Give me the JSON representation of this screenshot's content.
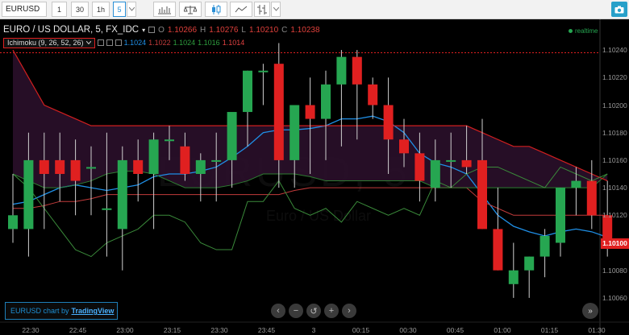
{
  "toolbar": {
    "symbol": "EURUSD",
    "intervals": [
      "1",
      "30",
      "1h",
      "5"
    ],
    "active_interval": "5",
    "icons": [
      "chevron-down-icon",
      "bars-chart-icon",
      "compare-scales-icon",
      "candles-icon",
      "line-chart-icon",
      "indicators-icon",
      "chevron-down-icon",
      "camera-icon"
    ]
  },
  "legend": {
    "title": "EURO / US DOLLAR, 5, FX_IDC",
    "caret": "▾",
    "ohlc": [
      {
        "label": "O",
        "value": "1.10266"
      },
      {
        "label": "H",
        "value": "1.10276"
      },
      {
        "label": "L",
        "value": "1.10210"
      },
      {
        "label": "C",
        "value": "1.10238"
      }
    ],
    "indicator": "Ichimoku (9, 26, 52, 26)",
    "indicator_values": [
      {
        "value": "1.1024",
        "color": "#1f8fe6"
      },
      {
        "value": "1.1022",
        "color": "#c23b3b"
      },
      {
        "value": "1.1024",
        "color": "#2e9e3e"
      },
      {
        "value": "1.1016",
        "color": "#2e9e3e"
      },
      {
        "value": "1.1014",
        "color": "#e04040"
      }
    ],
    "realtime": "realtime"
  },
  "watermark": {
    "symbol": "EURUSD, 5",
    "name": "Euro / US Dollar"
  },
  "footer": {
    "brand_prefix": "EURUSD chart by",
    "brand_name": "TradingView",
    "nav_buttons": [
      "‹",
      "−",
      "↺",
      "+",
      "›"
    ],
    "goto_end": "»"
  },
  "colors": {
    "up": "#26a651",
    "down": "#e02020",
    "tenkan": "#1f8fe6",
    "kijun": "#c23b3b",
    "chikou": "#3a8a3a",
    "cloud": "#2a0f2a",
    "span_a": "#2e7d32",
    "span_b": "#d11f1f"
  },
  "chart_data": {
    "type": "candlestick",
    "symbol": "EURUSD",
    "interval": "5",
    "ylim": [
      1.1005,
      1.1025
    ],
    "y_ticks": [
      "1.10240",
      "1.10220",
      "1.10200",
      "1.10180",
      "1.10160",
      "1.10140",
      "1.10120",
      "1.10100",
      "1.10080",
      "1.10060"
    ],
    "x_ticks": [
      "22:30",
      "22:45",
      "23:00",
      "23:15",
      "23:30",
      "23:45",
      "3",
      "00:15",
      "00:30",
      "00:45",
      "01:00",
      "01:15",
      "01:30"
    ],
    "last_price": "1.10100",
    "resistance_line": 1.10238,
    "candles": [
      {
        "o": 1.1011,
        "h": 1.1015,
        "l": 1.101,
        "c": 1.1012
      },
      {
        "o": 1.1011,
        "h": 1.1018,
        "l": 1.1009,
        "c": 1.1016
      },
      {
        "o": 1.1016,
        "h": 1.1018,
        "l": 1.1011,
        "c": 1.1015
      },
      {
        "o": 1.1016,
        "h": 1.1018,
        "l": 1.1013,
        "c": 1.1015
      },
      {
        "o": 1.1016,
        "h": 1.10175,
        "l": 1.1012,
        "c": 1.10145
      },
      {
        "o": 1.10155,
        "h": 1.1017,
        "l": 1.1012,
        "c": 1.10155
      },
      {
        "o": 1.10125,
        "h": 1.1018,
        "l": 1.1009,
        "c": 1.10125
      },
      {
        "o": 1.1011,
        "h": 1.1017,
        "l": 1.1008,
        "c": 1.1016
      },
      {
        "o": 1.1016,
        "h": 1.10175,
        "l": 1.1013,
        "c": 1.1015
      },
      {
        "o": 1.1015,
        "h": 1.1018,
        "l": 1.1011,
        "c": 1.10175
      },
      {
        "o": 1.10175,
        "h": 1.10185,
        "l": 1.1016,
        "c": 1.10175
      },
      {
        "o": 1.1017,
        "h": 1.1018,
        "l": 1.10145,
        "c": 1.1015
      },
      {
        "o": 1.1015,
        "h": 1.10165,
        "l": 1.1013,
        "c": 1.1016
      },
      {
        "o": 1.1016,
        "h": 1.1018,
        "l": 1.1013,
        "c": 1.1016
      },
      {
        "o": 1.1016,
        "h": 1.10175,
        "l": 1.1014,
        "c": 1.10195
      },
      {
        "o": 1.10195,
        "h": 1.10225,
        "l": 1.1017,
        "c": 1.10225
      },
      {
        "o": 1.10225,
        "h": 1.1023,
        "l": 1.102,
        "c": 1.10225
      },
      {
        "o": 1.1023,
        "h": 1.10245,
        "l": 1.1014,
        "c": 1.1016
      },
      {
        "o": 1.1016,
        "h": 1.10195,
        "l": 1.1014,
        "c": 1.102
      },
      {
        "o": 1.102,
        "h": 1.1022,
        "l": 1.1015,
        "c": 1.1019
      },
      {
        "o": 1.1019,
        "h": 1.10225,
        "l": 1.1016,
        "c": 1.10215
      },
      {
        "o": 1.10215,
        "h": 1.1024,
        "l": 1.1017,
        "c": 1.10235
      },
      {
        "o": 1.10235,
        "h": 1.1024,
        "l": 1.10175,
        "c": 1.10215
      },
      {
        "o": 1.10215,
        "h": 1.1022,
        "l": 1.1019,
        "c": 1.102
      },
      {
        "o": 1.102,
        "h": 1.1022,
        "l": 1.1015,
        "c": 1.10175
      },
      {
        "o": 1.10175,
        "h": 1.1019,
        "l": 1.10155,
        "c": 1.10165
      },
      {
        "o": 1.10165,
        "h": 1.1018,
        "l": 1.1013,
        "c": 1.10145
      },
      {
        "o": 1.1014,
        "h": 1.10175,
        "l": 1.1013,
        "c": 1.1016
      },
      {
        "o": 1.1016,
        "h": 1.1018,
        "l": 1.1014,
        "c": 1.1016
      },
      {
        "o": 1.1016,
        "h": 1.10185,
        "l": 1.1015,
        "c": 1.10155
      },
      {
        "o": 1.1016,
        "h": 1.1019,
        "l": 1.1011,
        "c": 1.1011
      },
      {
        "o": 1.1011,
        "h": 1.1014,
        "l": 1.1008,
        "c": 1.1008
      },
      {
        "o": 1.1007,
        "h": 1.101,
        "l": 1.1006,
        "c": 1.1008
      },
      {
        "o": 1.1008,
        "h": 1.1009,
        "l": 1.1006,
        "c": 1.1009
      },
      {
        "o": 1.1009,
        "h": 1.1011,
        "l": 1.10075,
        "c": 1.10105
      },
      {
        "o": 1.101,
        "h": 1.1014,
        "l": 1.1009,
        "c": 1.1014
      },
      {
        "o": 1.1014,
        "h": 1.10155,
        "l": 1.1012,
        "c": 1.10145
      },
      {
        "o": 1.10145,
        "h": 1.1016,
        "l": 1.1011,
        "c": 1.1012
      },
      {
        "o": 1.1012,
        "h": 1.10145,
        "l": 1.1009,
        "c": 1.101
      }
    ],
    "series": [
      {
        "name": "Tenkan",
        "values": [
          1.10128,
          1.1013,
          1.10135,
          1.1014,
          1.10142,
          1.1014,
          1.10138,
          1.1014,
          1.10142,
          1.10148,
          1.1015,
          1.1015,
          1.10152,
          1.10155,
          1.10162,
          1.1017,
          1.1018,
          1.10182,
          1.10182,
          1.10183,
          1.10185,
          1.1019,
          1.1019,
          1.10192,
          1.10188,
          1.1018,
          1.10165,
          1.10158,
          1.10155,
          1.1015,
          1.10135,
          1.1012,
          1.10112,
          1.10108,
          1.10105,
          1.10108,
          1.1011,
          1.10108,
          1.10104
        ]
      },
      {
        "name": "Kijun",
        "values": [
          1.10125,
          1.10125,
          1.10127,
          1.1013,
          1.1013,
          1.10132,
          1.10135,
          1.10135,
          1.10135,
          1.10135,
          1.10135,
          1.10135,
          1.10135,
          1.10135,
          1.10135,
          1.10135,
          1.10135,
          1.10135,
          1.10138,
          1.1014,
          1.1014,
          1.1014,
          1.1014,
          1.1014,
          1.1014,
          1.1014,
          1.1014,
          1.1014,
          1.1014,
          1.1014,
          1.1013,
          1.10125,
          1.1012,
          1.1012,
          1.1012,
          1.1012,
          1.1012,
          1.1012,
          1.1012
        ]
      },
      {
        "name": "Senkou A",
        "values": [
          1.1015,
          1.10145,
          1.1014,
          1.1014,
          1.10142,
          1.10145,
          1.1015,
          1.10152,
          1.10152,
          1.1015,
          1.10145,
          1.1014,
          1.1014,
          1.1014,
          1.10142,
          1.10145,
          1.1015,
          1.1015,
          1.1015,
          1.10148,
          1.10145,
          1.10145,
          1.10145,
          1.10145,
          1.10145,
          1.10145,
          1.10145,
          1.1014,
          1.1014,
          1.1014,
          1.1014,
          1.1014,
          1.1014,
          1.1014,
          1.1014,
          1.1014,
          1.1014,
          1.1014,
          1.1015
        ]
      },
      {
        "name": "Senkou B",
        "values": [
          1.1024,
          1.1022,
          1.102,
          1.10195,
          1.1019,
          1.10185,
          1.10185,
          1.10185,
          1.10185,
          1.10185,
          1.10185,
          1.10185,
          1.10185,
          1.10185,
          1.10185,
          1.10185,
          1.10185,
          1.10185,
          1.10185,
          1.10185,
          1.10185,
          1.10185,
          1.10185,
          1.10185,
          1.10185,
          1.10185,
          1.10185,
          1.10185,
          1.10185,
          1.10185,
          1.1018,
          1.10175,
          1.1017,
          1.1017,
          1.10165,
          1.1016,
          1.10155,
          1.1015,
          1.10145
        ]
      },
      {
        "name": "Chikou",
        "values": [
          1.1015,
          1.1014,
          1.10125,
          1.1011,
          1.10095,
          1.1009,
          1.101,
          1.10105,
          1.1011,
          1.1012,
          1.1012,
          1.10115,
          1.101,
          1.10095,
          1.10095,
          1.1013,
          1.1013,
          1.10145,
          1.10125,
          1.1012,
          1.10125,
          1.10115,
          1.1013,
          1.10125,
          1.1012,
          1.10125,
          1.1012,
          1.10145,
          1.1014,
          1.1015,
          1.10155,
          1.10155,
          1.1015,
          1.10145,
          1.1014,
          1.10155,
          1.1015,
          1.10145,
          1.1015
        ]
      }
    ]
  }
}
